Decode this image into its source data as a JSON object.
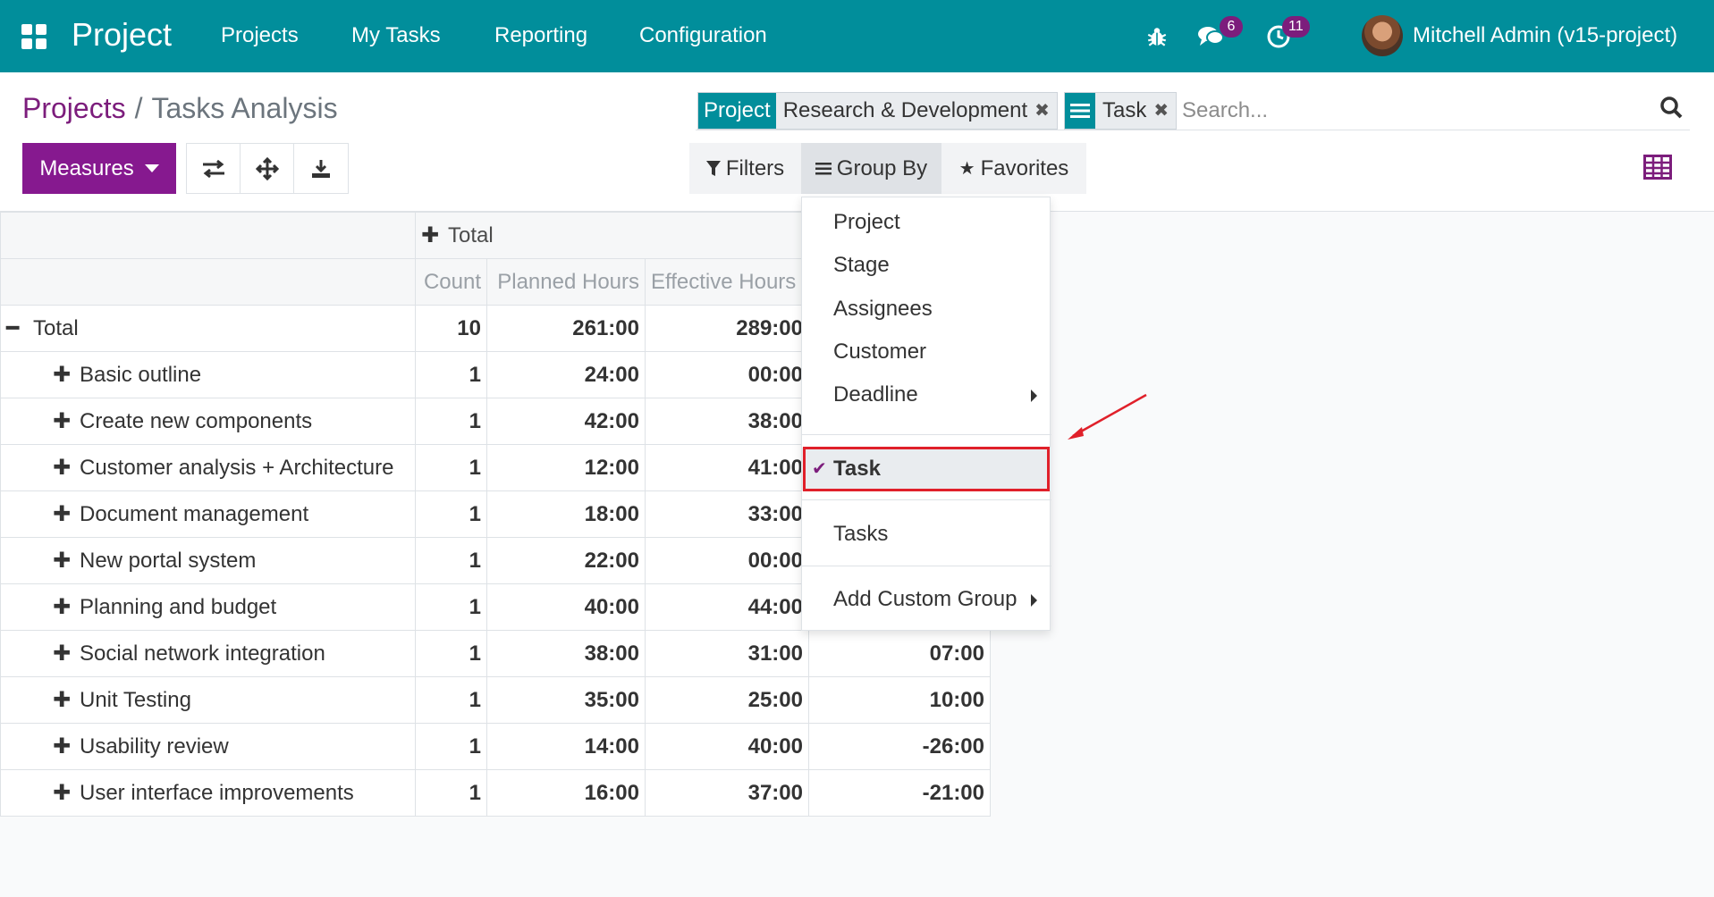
{
  "navbar": {
    "brand": "Project",
    "menu": [
      "Projects",
      "My Tasks",
      "Reporting",
      "Configuration"
    ],
    "messages_count": "6",
    "activities_count": "11",
    "user_name": "Mitchell Admin (v15-project)"
  },
  "breadcrumb": {
    "parent": "Projects",
    "separator": "/",
    "current": "Tasks Analysis"
  },
  "buttons": {
    "measures": "Measures"
  },
  "search": {
    "facets": [
      {
        "label": "Project",
        "value": "Research & Development"
      },
      {
        "label_icon": "list-icon",
        "value": "Task"
      }
    ],
    "placeholder": "Search..."
  },
  "search_options": {
    "filters": "Filters",
    "group_by": "Group By",
    "favorites": "Favorites"
  },
  "group_by_menu": {
    "items": [
      "Project",
      "Stage",
      "Assignees",
      "Customer",
      "Deadline"
    ],
    "selected": "Task",
    "extra": "Tasks",
    "custom": "Add Custom Group"
  },
  "pivot": {
    "col_total": "Total",
    "measures": [
      "Count",
      "Planned Hours",
      "Effective Hours"
    ],
    "row_total": {
      "label": "Total",
      "count": "10",
      "planned": "261:00",
      "effective": "289:00"
    },
    "rows": [
      {
        "label": "Basic outline",
        "count": "1",
        "planned": "24:00",
        "effective": "00:00",
        "remaining": ""
      },
      {
        "label": "Create new components",
        "count": "1",
        "planned": "42:00",
        "effective": "38:00",
        "remaining": ""
      },
      {
        "label": "Customer analysis + Architecture",
        "count": "1",
        "planned": "12:00",
        "effective": "41:00",
        "remaining": ""
      },
      {
        "label": "Document management",
        "count": "1",
        "planned": "18:00",
        "effective": "33:00",
        "remaining": ""
      },
      {
        "label": "New portal system",
        "count": "1",
        "planned": "22:00",
        "effective": "00:00",
        "remaining": ""
      },
      {
        "label": "Planning and budget",
        "count": "1",
        "planned": "40:00",
        "effective": "44:00",
        "remaining": ""
      },
      {
        "label": "Social network integration",
        "count": "1",
        "planned": "38:00",
        "effective": "31:00",
        "remaining": "07:00"
      },
      {
        "label": "Unit Testing",
        "count": "1",
        "planned": "35:00",
        "effective": "25:00",
        "remaining": "10:00"
      },
      {
        "label": "Usability review",
        "count": "1",
        "planned": "14:00",
        "effective": "40:00",
        "remaining": "-26:00"
      },
      {
        "label": "User interface improvements",
        "count": "1",
        "planned": "16:00",
        "effective": "37:00",
        "remaining": "-21:00"
      }
    ]
  },
  "colors": {
    "navbar": "#018e9b",
    "primary": "#86198f",
    "badge": "#7c1d7c",
    "highlight": "#e0202a"
  }
}
